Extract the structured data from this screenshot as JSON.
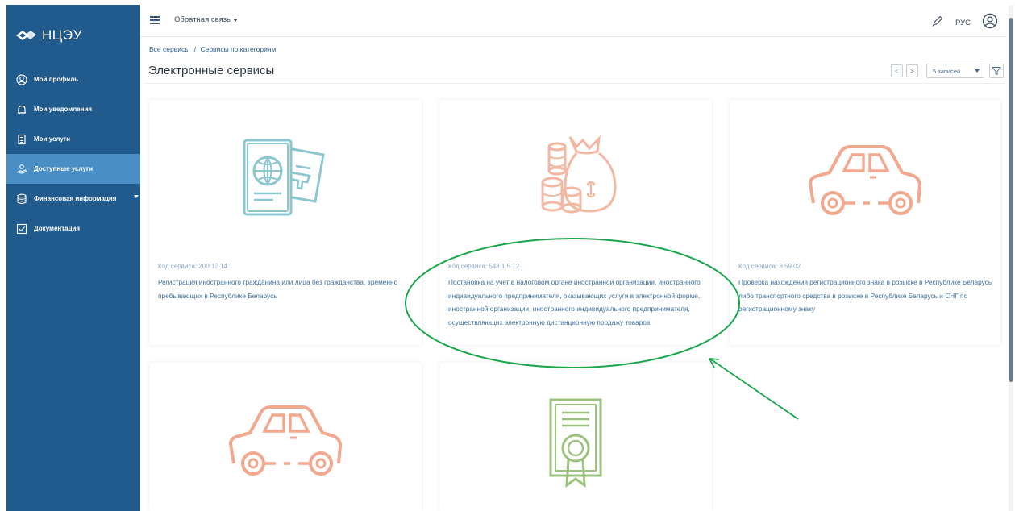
{
  "sidebar": {
    "logo_text": "НЦЭУ",
    "items": [
      {
        "label": "Мой профиль",
        "icon": "user-circle-icon",
        "active": false
      },
      {
        "label": "Мои уведомления",
        "icon": "bell-icon",
        "active": false
      },
      {
        "label": "Мои услуги",
        "icon": "document-list-icon",
        "active": false
      },
      {
        "label": "Доступные услуги",
        "icon": "hand-services-icon",
        "active": true
      },
      {
        "label": "Финансовая информация",
        "icon": "database-icon",
        "active": false,
        "has_caret": true
      },
      {
        "label": "Документация",
        "icon": "checkbox-icon",
        "active": false
      }
    ]
  },
  "topbar": {
    "feedback_label": "Обратная связь",
    "lang_label": "РУС"
  },
  "breadcrumb": {
    "root": "Все сервисы",
    "separator": "/",
    "current": "Сервисы по категориям"
  },
  "page": {
    "title": "Электронные сервисы"
  },
  "pager": {
    "prev": "<",
    "next": ">",
    "records_selected": "5 записей"
  },
  "cards": [
    {
      "illustration": "passport-icon",
      "code_label": "Код сервиса: 200.12.14.1",
      "description": "Регистрация иностранного гражданина или лица без гражданства, временно пребывающих в Республике Беларусь"
    },
    {
      "illustration": "money-bag-icon",
      "code_label": "Код сервиса: 548.1.5.12",
      "description": "Постановка на учет в налоговом органе иностранной организации, иностранного индивидуального предпринимателя, оказывающих услуги в электронной форме, иностранной организации, иностранного индивидуального предпринимателя, осуществляющих электронную дистанционную продажу товаров"
    },
    {
      "illustration": "car-icon",
      "code_label": "Код сервиса: 3.59.02",
      "description": "Проверка нахождения регистрационного знака в розыске в Республике Беларусь либо транспортного средства в розыске в Республике Беларусь и СНГ по регистрационному знаку"
    },
    {
      "illustration": "car-icon",
      "code_label": "",
      "description": ""
    },
    {
      "illustration": "certificate-icon",
      "code_label": "",
      "description": ""
    }
  ],
  "colors": {
    "sidebar_bg": "#215a8c",
    "sidebar_active": "#4a8ec6",
    "passport": "#8cc7cf",
    "money": "#f2b8a2",
    "car": "#f2a88e",
    "certificate": "#9cc27f",
    "annotation": "#1aa64a"
  }
}
